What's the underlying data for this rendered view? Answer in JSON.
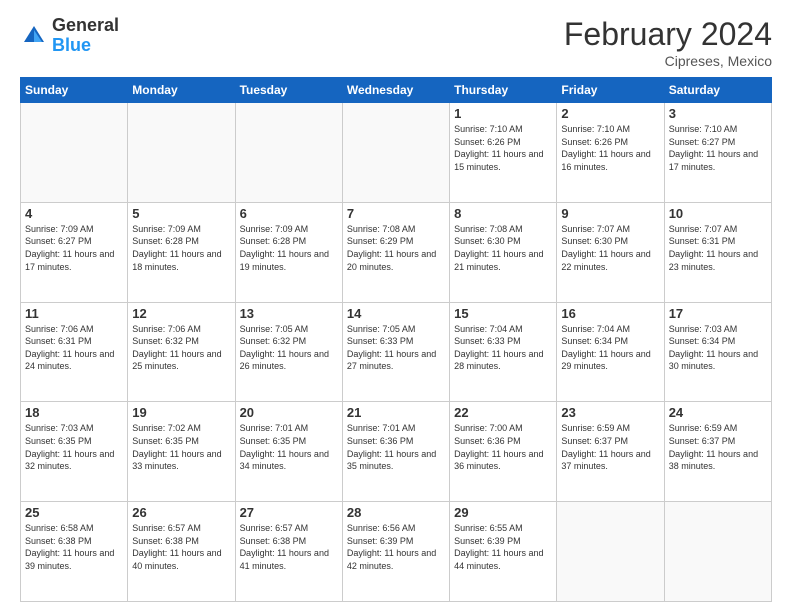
{
  "header": {
    "logo_general": "General",
    "logo_blue": "Blue",
    "title": "February 2024",
    "location": "Cipreses, Mexico"
  },
  "days_of_week": [
    "Sunday",
    "Monday",
    "Tuesday",
    "Wednesday",
    "Thursday",
    "Friday",
    "Saturday"
  ],
  "weeks": [
    [
      {
        "day": "",
        "info": ""
      },
      {
        "day": "",
        "info": ""
      },
      {
        "day": "",
        "info": ""
      },
      {
        "day": "",
        "info": ""
      },
      {
        "day": "1",
        "info": "Sunrise: 7:10 AM\nSunset: 6:26 PM\nDaylight: 11 hours and 15 minutes."
      },
      {
        "day": "2",
        "info": "Sunrise: 7:10 AM\nSunset: 6:26 PM\nDaylight: 11 hours and 16 minutes."
      },
      {
        "day": "3",
        "info": "Sunrise: 7:10 AM\nSunset: 6:27 PM\nDaylight: 11 hours and 17 minutes."
      }
    ],
    [
      {
        "day": "4",
        "info": "Sunrise: 7:09 AM\nSunset: 6:27 PM\nDaylight: 11 hours and 17 minutes."
      },
      {
        "day": "5",
        "info": "Sunrise: 7:09 AM\nSunset: 6:28 PM\nDaylight: 11 hours and 18 minutes."
      },
      {
        "day": "6",
        "info": "Sunrise: 7:09 AM\nSunset: 6:28 PM\nDaylight: 11 hours and 19 minutes."
      },
      {
        "day": "7",
        "info": "Sunrise: 7:08 AM\nSunset: 6:29 PM\nDaylight: 11 hours and 20 minutes."
      },
      {
        "day": "8",
        "info": "Sunrise: 7:08 AM\nSunset: 6:30 PM\nDaylight: 11 hours and 21 minutes."
      },
      {
        "day": "9",
        "info": "Sunrise: 7:07 AM\nSunset: 6:30 PM\nDaylight: 11 hours and 22 minutes."
      },
      {
        "day": "10",
        "info": "Sunrise: 7:07 AM\nSunset: 6:31 PM\nDaylight: 11 hours and 23 minutes."
      }
    ],
    [
      {
        "day": "11",
        "info": "Sunrise: 7:06 AM\nSunset: 6:31 PM\nDaylight: 11 hours and 24 minutes."
      },
      {
        "day": "12",
        "info": "Sunrise: 7:06 AM\nSunset: 6:32 PM\nDaylight: 11 hours and 25 minutes."
      },
      {
        "day": "13",
        "info": "Sunrise: 7:05 AM\nSunset: 6:32 PM\nDaylight: 11 hours and 26 minutes."
      },
      {
        "day": "14",
        "info": "Sunrise: 7:05 AM\nSunset: 6:33 PM\nDaylight: 11 hours and 27 minutes."
      },
      {
        "day": "15",
        "info": "Sunrise: 7:04 AM\nSunset: 6:33 PM\nDaylight: 11 hours and 28 minutes."
      },
      {
        "day": "16",
        "info": "Sunrise: 7:04 AM\nSunset: 6:34 PM\nDaylight: 11 hours and 29 minutes."
      },
      {
        "day": "17",
        "info": "Sunrise: 7:03 AM\nSunset: 6:34 PM\nDaylight: 11 hours and 30 minutes."
      }
    ],
    [
      {
        "day": "18",
        "info": "Sunrise: 7:03 AM\nSunset: 6:35 PM\nDaylight: 11 hours and 32 minutes."
      },
      {
        "day": "19",
        "info": "Sunrise: 7:02 AM\nSunset: 6:35 PM\nDaylight: 11 hours and 33 minutes."
      },
      {
        "day": "20",
        "info": "Sunrise: 7:01 AM\nSunset: 6:35 PM\nDaylight: 11 hours and 34 minutes."
      },
      {
        "day": "21",
        "info": "Sunrise: 7:01 AM\nSunset: 6:36 PM\nDaylight: 11 hours and 35 minutes."
      },
      {
        "day": "22",
        "info": "Sunrise: 7:00 AM\nSunset: 6:36 PM\nDaylight: 11 hours and 36 minutes."
      },
      {
        "day": "23",
        "info": "Sunrise: 6:59 AM\nSunset: 6:37 PM\nDaylight: 11 hours and 37 minutes."
      },
      {
        "day": "24",
        "info": "Sunrise: 6:59 AM\nSunset: 6:37 PM\nDaylight: 11 hours and 38 minutes."
      }
    ],
    [
      {
        "day": "25",
        "info": "Sunrise: 6:58 AM\nSunset: 6:38 PM\nDaylight: 11 hours and 39 minutes."
      },
      {
        "day": "26",
        "info": "Sunrise: 6:57 AM\nSunset: 6:38 PM\nDaylight: 11 hours and 40 minutes."
      },
      {
        "day": "27",
        "info": "Sunrise: 6:57 AM\nSunset: 6:38 PM\nDaylight: 11 hours and 41 minutes."
      },
      {
        "day": "28",
        "info": "Sunrise: 6:56 AM\nSunset: 6:39 PM\nDaylight: 11 hours and 42 minutes."
      },
      {
        "day": "29",
        "info": "Sunrise: 6:55 AM\nSunset: 6:39 PM\nDaylight: 11 hours and 44 minutes."
      },
      {
        "day": "",
        "info": ""
      },
      {
        "day": "",
        "info": ""
      }
    ]
  ]
}
